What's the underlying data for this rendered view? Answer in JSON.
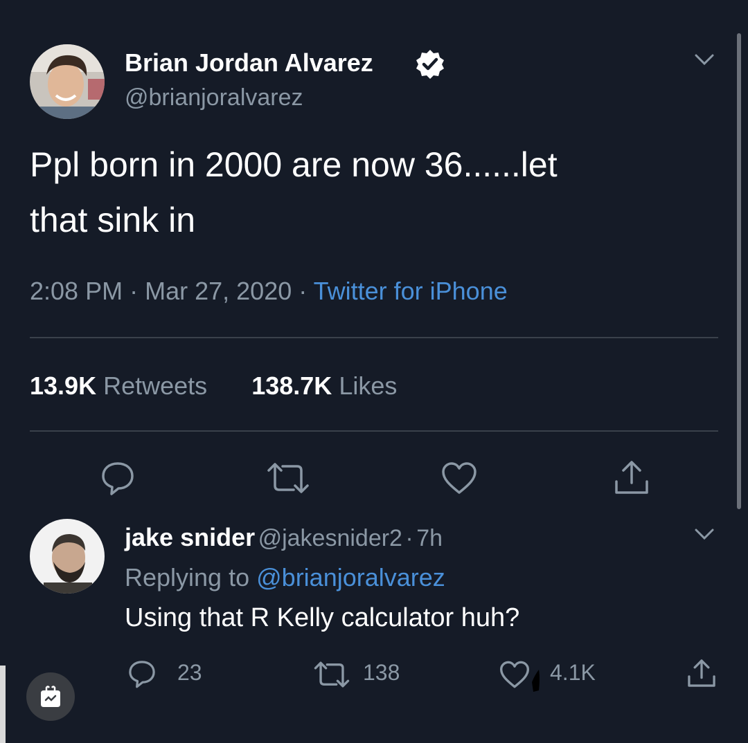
{
  "tweet": {
    "author_name": "Brian Jordan Alvarez",
    "author_handle": "@brianjoralvarez",
    "text_line1": "Ppl born in 2000 are now 36......let",
    "text_line2": "that sink in",
    "time": "2:08 PM",
    "date": "Mar 27, 2020",
    "sep": "·",
    "source": "Twitter for iPhone",
    "retweets_count": "13.9K",
    "retweets_label": "Retweets",
    "likes_count": "138.7K",
    "likes_label": "Likes"
  },
  "reply": {
    "author_name": "jake snider",
    "author_handle": "@jakesnider2",
    "sep": "·",
    "time": "7h",
    "replying_to_label": "Replying to",
    "replying_to_handle": "@brianjoralvarez",
    "text": "Using that R Kelly calculator huh?",
    "replies": "23",
    "retweets": "138",
    "likes": "4.1K"
  },
  "colors": {
    "background": "#151b27",
    "link": "#4a90d9",
    "muted": "#8b98a5",
    "verified": "#ffffff"
  },
  "icons": [
    "verified-badge-icon",
    "chevron-down-icon",
    "reply-icon",
    "retweet-icon",
    "like-icon",
    "share-icon",
    "app-badge-icon"
  ]
}
